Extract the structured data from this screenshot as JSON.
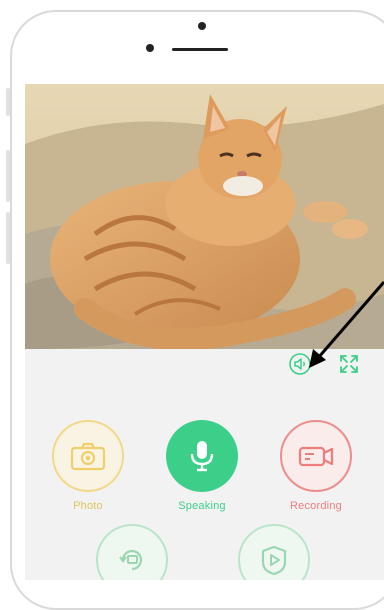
{
  "header": {},
  "camera_controls": {
    "mute_icon": "speaker-mute-icon",
    "fullscreen_icon": "fullscreen-icon"
  },
  "actions": [
    {
      "label": "Photo",
      "icon": "camera-icon",
      "color": "#f2d98a"
    },
    {
      "label": "Speaking",
      "icon": "microphone-icon",
      "color": "#3ccf8a"
    },
    {
      "label": "Recording",
      "icon": "video-camera-icon",
      "color": "#f08c8c"
    }
  ],
  "secondary_actions": [
    {
      "icon": "playback-icon",
      "color": "#b9e5c9"
    },
    {
      "icon": "video-library-icon",
      "color": "#b9e5c9"
    }
  ],
  "colors": {
    "accent_green": "#3ccf8a",
    "photo_yellow": "#f2d98a",
    "recording_red": "#f08c8c",
    "background": "#f2f2f2"
  }
}
